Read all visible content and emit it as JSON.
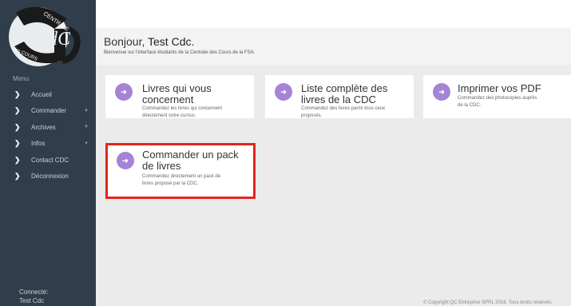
{
  "logo": {
    "top_text": "CENTRALE",
    "bottom_text": "des COURS",
    "mono": "CdC"
  },
  "sidebar": {
    "menu_title": "Menu",
    "items": [
      {
        "label": "Accueil",
        "has_caret": false
      },
      {
        "label": "Commander",
        "has_caret": true
      },
      {
        "label": "Archives",
        "has_caret": true
      },
      {
        "label": "Infos",
        "has_caret": true
      },
      {
        "label": "Contact CDC",
        "has_caret": false
      },
      {
        "label": "Déconnexion",
        "has_caret": false
      }
    ],
    "connected_label": "Connecté:",
    "connected_user": "Test Cdc"
  },
  "header": {
    "greeting": "Bonjour, ",
    "user": "Test Cdc",
    "greeting_end": ".",
    "subtitle": "Bienvenue sur l'interface étudiants de la Centrale des Cours de la FSA."
  },
  "cards": [
    {
      "title_line1": "Livres qui vous",
      "title_line2": "concernent",
      "desc_line1": "Commandez les livres qui concernent",
      "desc_line2": "directement votre cursus."
    },
    {
      "title_line1": "Liste complète des",
      "title_line2": "livres de la CDC",
      "desc_line1": "Commandez des livres parmi tous ceux",
      "desc_line2": "proposés."
    },
    {
      "title_line1": "Imprimer vos PDF",
      "desc_line1": "Commandez des photocopies auprès",
      "desc_line2": "de la CDC."
    },
    {
      "title_line1": "Commander un pack",
      "title_line2": "de livres",
      "desc_line1": "Commandez directement un pack de",
      "desc_line2": "livres proposé par la CDC."
    }
  ],
  "footer": {
    "text": "© Copyright QC Entreprise SPRL 2018. Tous droits réservés."
  },
  "colors": {
    "sidebar": "#2f3e4a",
    "accent": "#a583d6",
    "highlight": "#e3261c"
  },
  "icons": {
    "menu_chevron": "chevron-right-icon",
    "menu_caret": "caret-down-icon",
    "card_icon": "arrow-right-circle-icon"
  }
}
